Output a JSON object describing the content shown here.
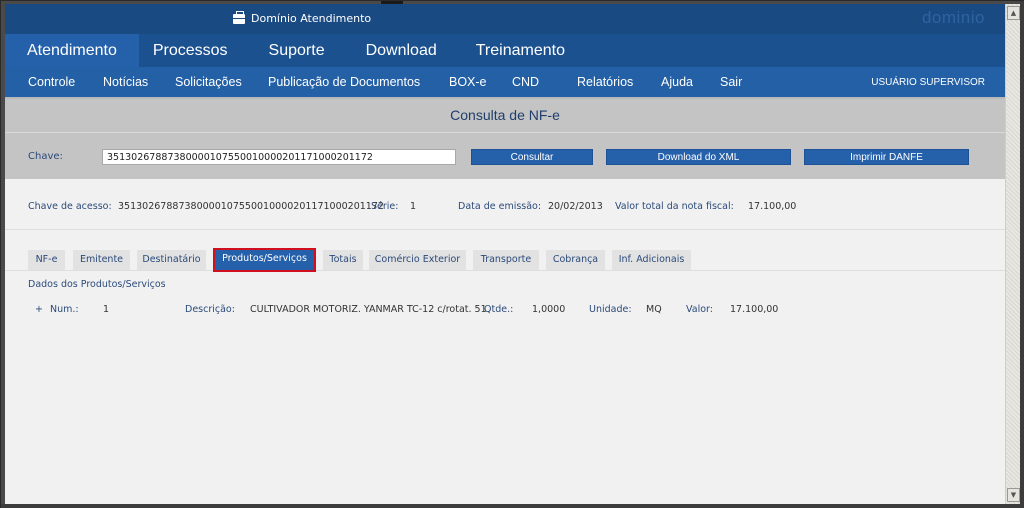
{
  "brand": {
    "title": "Domínio Atendimento",
    "logo": "dominio",
    "icon": "briefcase-icon"
  },
  "main_nav": [
    {
      "label": "Atendimento",
      "active": true
    },
    {
      "label": "Processos",
      "active": false
    },
    {
      "label": "Suporte",
      "active": false
    },
    {
      "label": "Download",
      "active": false
    },
    {
      "label": "Treinamento",
      "active": false
    }
  ],
  "sub_nav": [
    {
      "label": "Controle"
    },
    {
      "label": "Notícias"
    },
    {
      "label": "Solicitações"
    },
    {
      "label": "Publicação de Documentos"
    },
    {
      "label": "BOX-e"
    },
    {
      "label": "CND"
    },
    {
      "label": "Relatórios"
    },
    {
      "label": "Ajuda"
    },
    {
      "label": "Sair"
    }
  ],
  "user": {
    "label": "USUÁRIO SUPERVISOR"
  },
  "consulta": {
    "title": "Consulta de NF-e",
    "chave_label": "Chave:",
    "chave_value": "35130267887380000107550010000201171000201172",
    "buttons": {
      "consultar": "Consultar",
      "download_xml": "Download do XML",
      "imprimir_danfe": "Imprimir DANFE"
    }
  },
  "info": {
    "chave_acesso_label": "Chave de acesso:",
    "chave_acesso_value": "35130267887380000107550010000201171000201172",
    "serie_label": "Série:",
    "serie_value": "1",
    "data_emissao_label": "Data de emissão:",
    "data_emissao_value": "20/02/2013",
    "valor_total_label": "Valor total da nota fiscal:",
    "valor_total_value": "17.100,00"
  },
  "tabs": [
    {
      "label": "NF-e",
      "active": false
    },
    {
      "label": "Emitente",
      "active": false
    },
    {
      "label": "Destinatário",
      "active": false
    },
    {
      "label": "Produtos/Serviços",
      "active": true
    },
    {
      "label": "Totais",
      "active": false
    },
    {
      "label": "Comércio Exterior",
      "active": false
    },
    {
      "label": "Transporte",
      "active": false
    },
    {
      "label": "Cobrança",
      "active": false
    },
    {
      "label": "Inf. Adicionais",
      "active": false
    }
  ],
  "produtos": {
    "section_title": "Dados dos Produtos/Serviços",
    "items": [
      {
        "expand_symbol": "+",
        "num_label": "Num.:",
        "num_value": "1",
        "descricao_label": "Descrição:",
        "descricao_value": "CULTIVADOR MOTORIZ. YANMAR TC-12 c/rotat. 51",
        "qtde_label": "Qtde.:",
        "qtde_value": "1,0000",
        "unidade_label": "Unidade:",
        "unidade_value": "MQ",
        "valor_label": "Valor:",
        "valor_value": "17.100,00"
      }
    ]
  },
  "colors": {
    "brand_bar": "#1a4a82",
    "main_nav": "#1c5190",
    "sub_nav": "#2360a6",
    "button": "#2560aa",
    "active_tab_highlight": "#d0101f",
    "label_text": "#2b4a7a"
  }
}
